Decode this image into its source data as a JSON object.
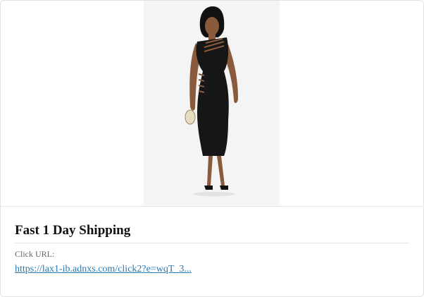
{
  "ad": {
    "image_alt": "Woman in black fitted cutout midi dress",
    "title": "Fast 1 Day Shipping",
    "click_url_label": "Click URL:",
    "click_url": "https://lax1-ib.adnxs.com/click2?e=wqT_3..."
  },
  "colors": {
    "link": "#2a7ab0",
    "dress": "#161616",
    "background": "#f3f3f3"
  }
}
